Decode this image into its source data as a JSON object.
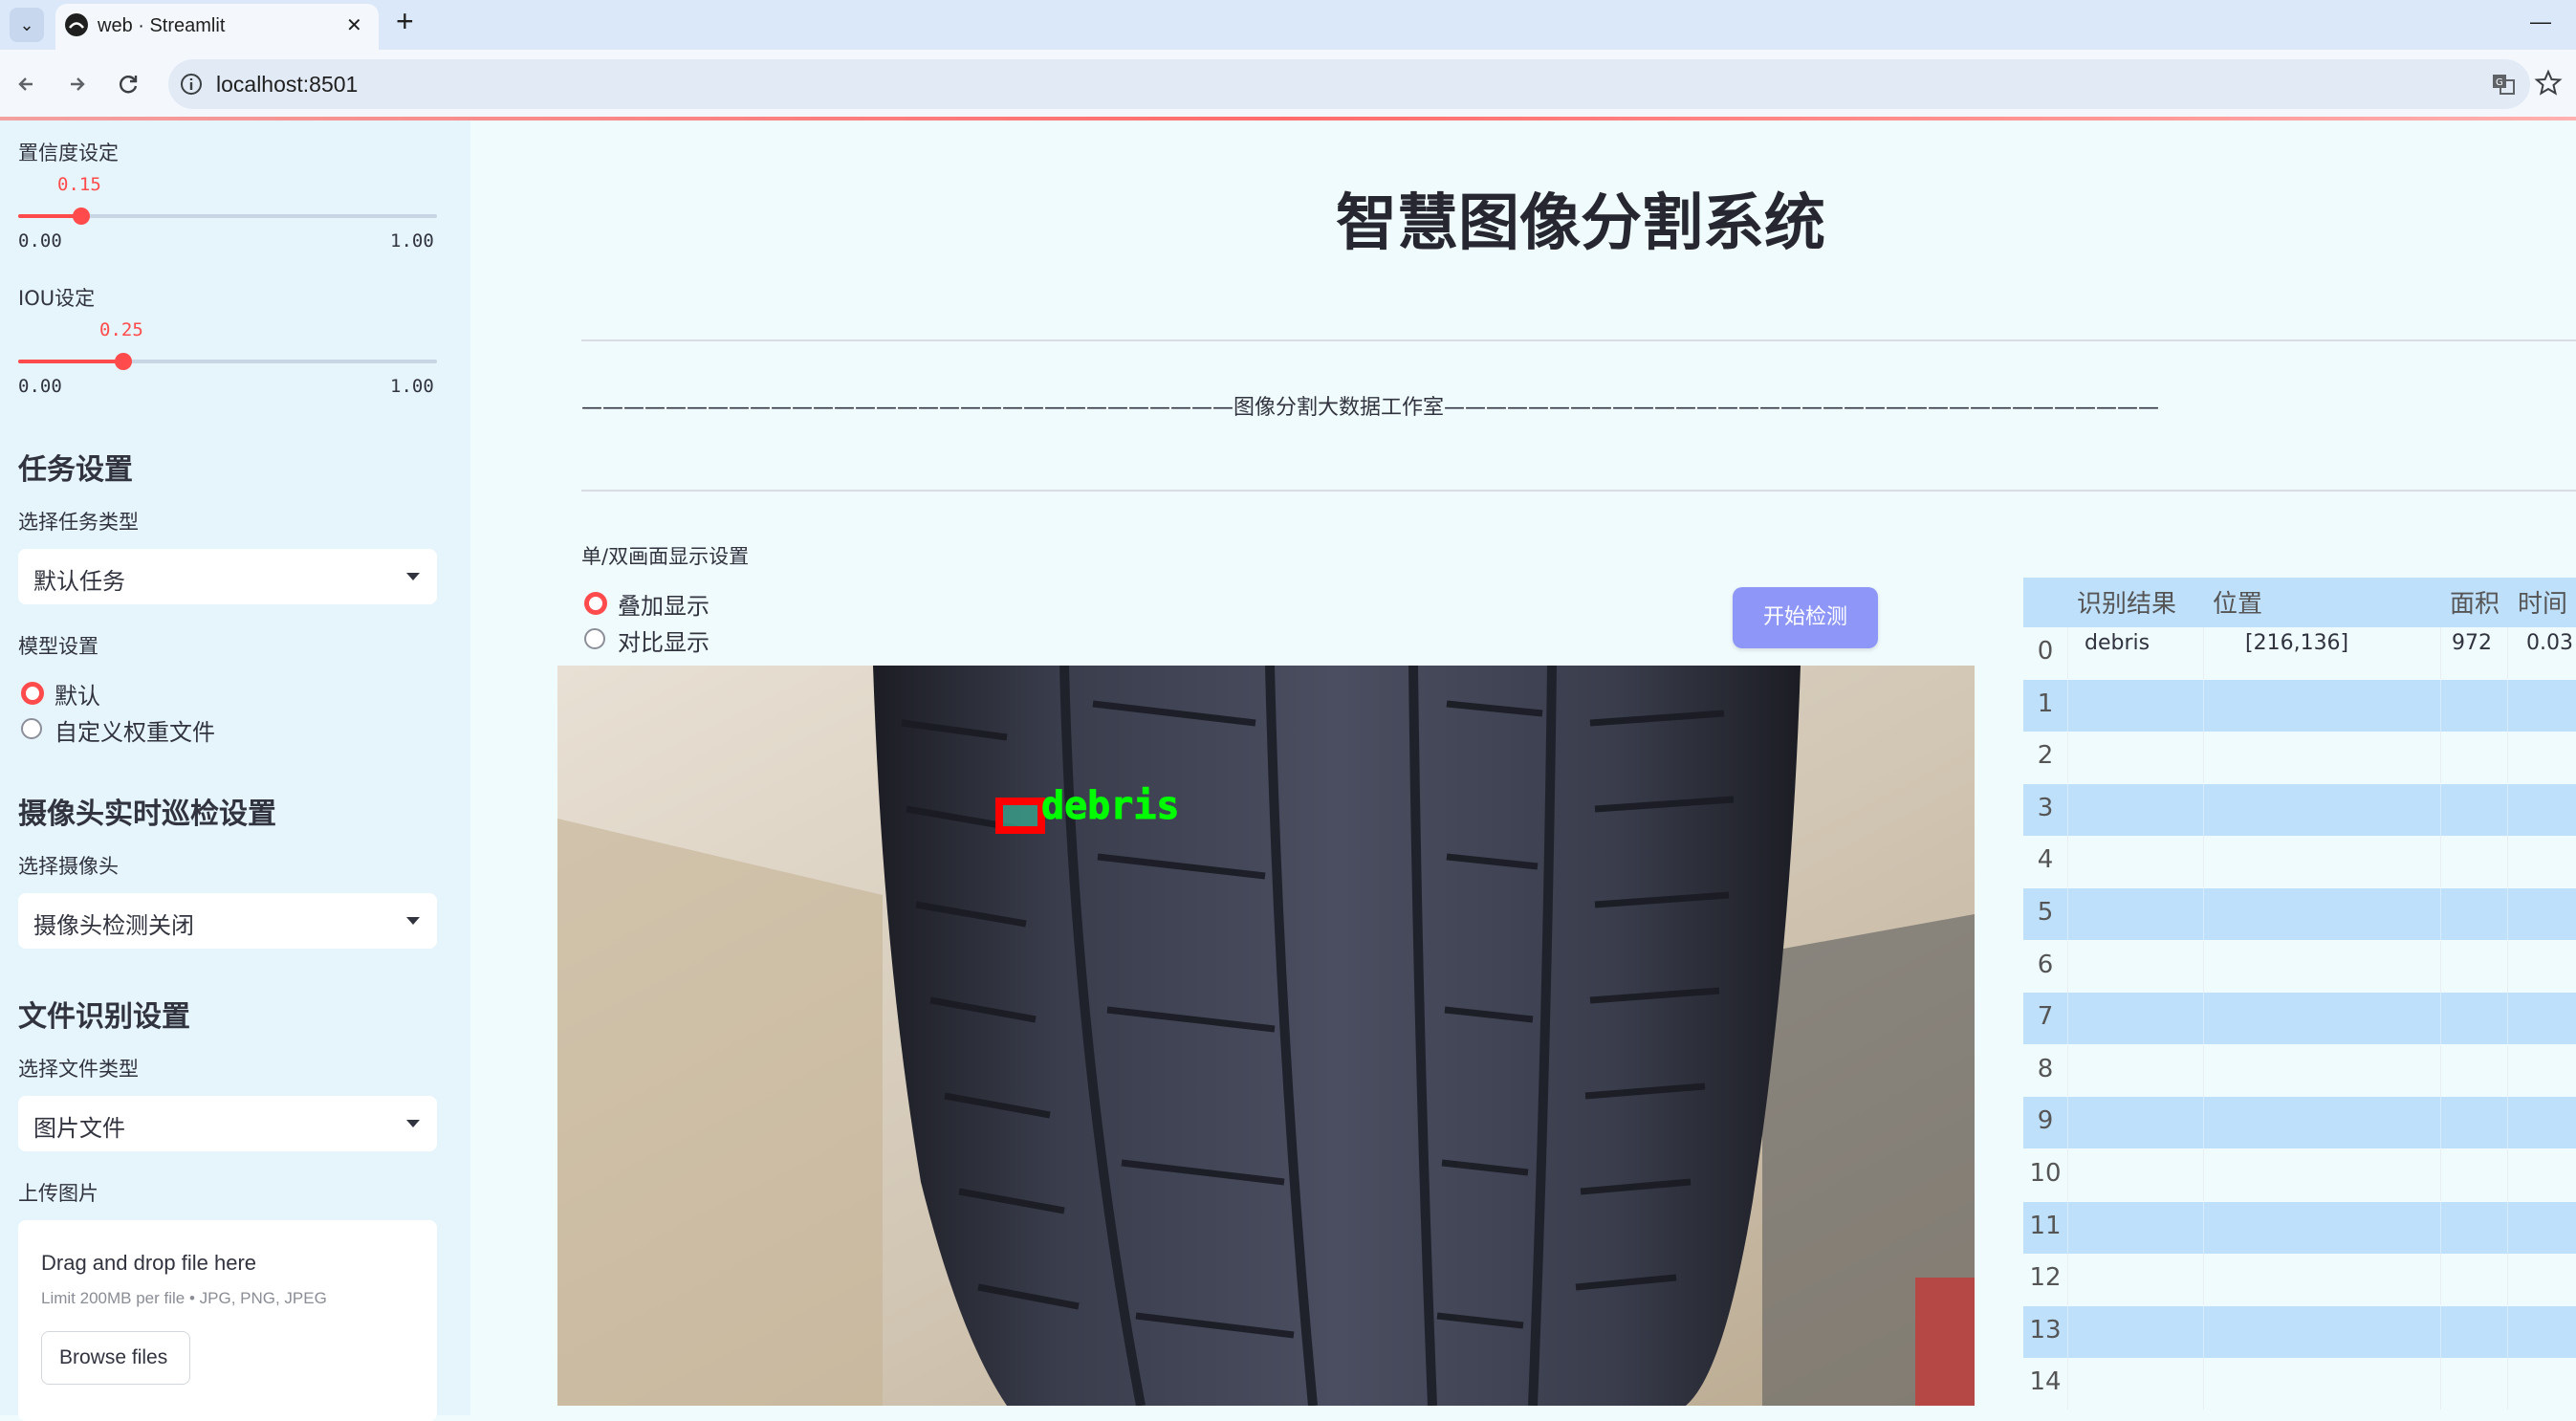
{
  "browser": {
    "tab_title": "web · Streamlit",
    "new_tab_symbol": "+",
    "close_symbol": "✕",
    "url": "localhost:8501",
    "minimize_symbol": "—"
  },
  "sidebar": {
    "confidence": {
      "label": "置信度设定",
      "value_text": "0.15",
      "value": 0.15,
      "min": "0.00",
      "max": "1.00"
    },
    "iou": {
      "label": "IOU设定",
      "value_text": "0.25",
      "value": 0.25,
      "min": "0.00",
      "max": "1.00"
    },
    "task_section": {
      "title": "任务设置",
      "select_label": "选择任务类型",
      "selected": "默认任务"
    },
    "model_section": {
      "label": "模型设置",
      "options": [
        "默认",
        "自定义权重文件"
      ],
      "selected_index": 0
    },
    "camera_section": {
      "title": "摄像头实时巡检设置",
      "select_label": "选择摄像头",
      "selected": "摄像头检测关闭"
    },
    "file_section": {
      "title": "文件识别设置",
      "select_label": "选择文件类型",
      "selected": "图片文件"
    },
    "upload": {
      "label": "上传图片",
      "drop_text": "Drag and drop file here",
      "limit_text": "Limit 200MB per file • JPG, PNG, JPEG",
      "browse_label": "Browse files"
    }
  },
  "main": {
    "title": "智慧图像分割系统",
    "banner": "———————————————————————————————图像分割大数据工作室——————————————————————————————————",
    "display_label": "单/双画面显示设置",
    "display_options": [
      "叠加显示",
      "对比显示"
    ],
    "display_selected_index": 0,
    "start_button": "开始检测",
    "detection_label": "debris"
  },
  "results_table": {
    "columns": [
      "识别结果",
      "位置",
      "面积",
      "时间"
    ],
    "rows": [
      {
        "index": "0",
        "result": "debris",
        "position": "[216,136]",
        "area": "972",
        "time": "0.03"
      },
      {
        "index": "1"
      },
      {
        "index": "2"
      },
      {
        "index": "3"
      },
      {
        "index": "4"
      },
      {
        "index": "5"
      },
      {
        "index": "6"
      },
      {
        "index": "7"
      },
      {
        "index": "8"
      },
      {
        "index": "9"
      },
      {
        "index": "10"
      },
      {
        "index": "11"
      },
      {
        "index": "12"
      },
      {
        "index": "13"
      },
      {
        "index": "14"
      }
    ]
  },
  "colors": {
    "accent": "#ff4b4b",
    "button": "#8e97f7",
    "table_stripe": "#bfe0fb",
    "detection_box": "#ff0000",
    "detection_text": "#00ff00"
  }
}
